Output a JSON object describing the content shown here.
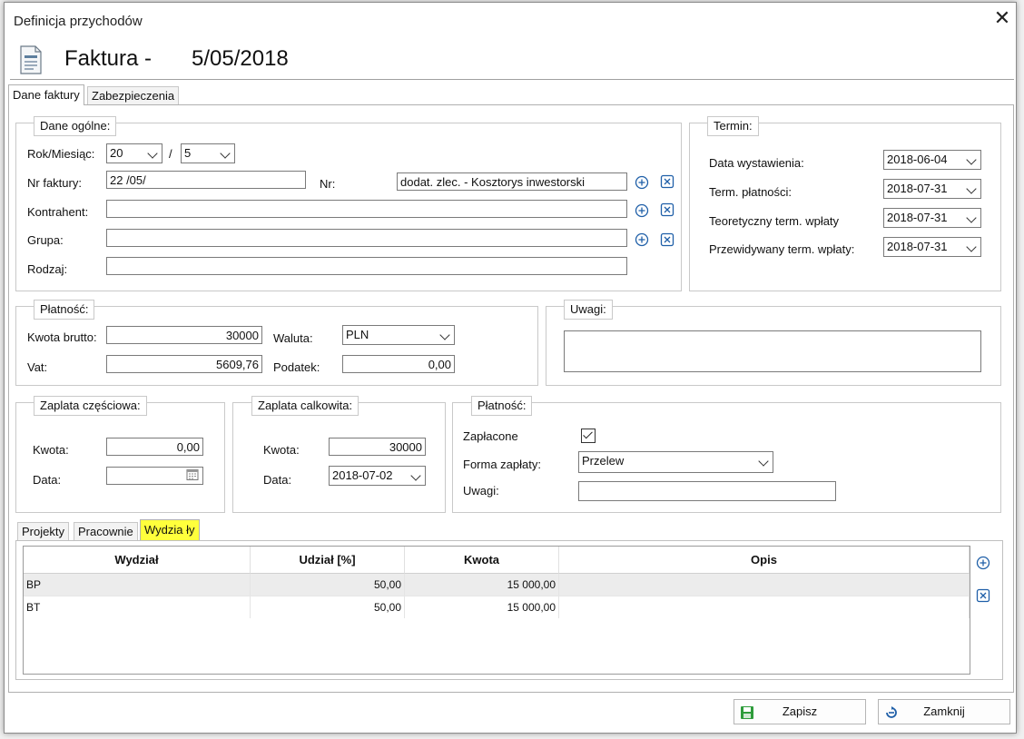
{
  "window": {
    "title": "Definicja przychodów"
  },
  "header": {
    "doc_type": "Faktura -",
    "doc_date": "5/05/2018"
  },
  "tabs": [
    "Dane faktury",
    "Zabezpieczenia"
  ],
  "dane_ogolne": {
    "legend": "Dane ogólne:",
    "rok_miesiac_label": "Rok/Miesiąc:",
    "rok_value": "20",
    "slash": "/",
    "miesiac_value": "5",
    "nr_faktury_label": "Nr faktury:",
    "nr_faktury_value": "22   /05/",
    "nr_label": "Nr:",
    "nr_value": "dodat. zlec. - Kosztorys inwestorski",
    "kontrahent_label": "Kontrahent:",
    "kontrahent_value": "",
    "grupa_label": "Grupa:",
    "grupa_value": "",
    "rodzaj_label": "Rodzaj:",
    "rodzaj_value": ""
  },
  "termin": {
    "legend": "Termin:",
    "data_wystawienia_label": "Data wystawienia:",
    "data_wystawienia_value": "2018-06-04",
    "term_platnosci_label": "Term. płatności:",
    "term_platnosci_value": "2018-07-31",
    "teoretyczny_label": "Teoretyczny term. wpłaty",
    "teoretyczny_value": "2018-07-31",
    "przewidywany_label": "Przewidywany term. wpłaty:",
    "przewidywany_value": "2018-07-31"
  },
  "platnosc": {
    "legend": "Płatność:",
    "kwota_brutto_label": "Kwota brutto:",
    "kwota_brutto_value": "30000",
    "vat_label": "Vat:",
    "vat_value": "5609,76",
    "waluta_label": "Waluta:",
    "waluta_value": "PLN",
    "podatek_label": "Podatek:",
    "podatek_value": "0,00"
  },
  "uwagi": {
    "legend": "Uwagi:",
    "value": ""
  },
  "zaplata_czesciowa": {
    "legend": "Zaplata częściowa:",
    "kwota_label": "Kwota:",
    "kwota_value": "0,00",
    "data_label": "Data:",
    "data_value": ""
  },
  "zaplata_calkowita": {
    "legend": "Zaplata calkowita:",
    "kwota_label": "Kwota:",
    "kwota_value": "30000",
    "data_label": "Data:",
    "data_value": "2018-07-02"
  },
  "platnosc2": {
    "legend": "Płatność:",
    "zaplacone_label": "Zapłacone",
    "zaplacone_checked": true,
    "forma_label": "Forma zapłaty:",
    "forma_value": "Przelew",
    "uwagi_label": "Uwagi:",
    "uwagi_value": ""
  },
  "subtabs": [
    "Projekty",
    "Pracownie",
    "Wydzia ły"
  ],
  "grid": {
    "columns": [
      "Wydział",
      "Udział [%]",
      "Kwota",
      "Opis"
    ],
    "rows": [
      {
        "wydzial": "BP",
        "udzial": "50,00",
        "kwota": "15 000,00",
        "opis": ""
      },
      {
        "wydzial": "BT",
        "udzial": "50,00",
        "kwota": "15 000,00",
        "opis": ""
      }
    ]
  },
  "buttons": {
    "save": "Zapisz",
    "close": "Zamknij"
  },
  "colors": {
    "highlight": "#ffff3c",
    "save_icon": "#2e9c3b",
    "icon_blue": "#1f5fa8"
  }
}
